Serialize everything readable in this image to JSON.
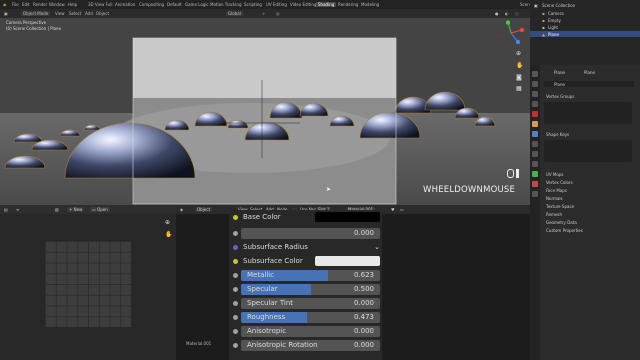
{
  "menu": {
    "items": [
      "File",
      "Edit",
      "Render",
      "Window",
      "Help"
    ],
    "workspaces": [
      "3D View Full",
      "Animation",
      "Compositing",
      "Default",
      "Game Logic",
      "Motion Tracking",
      "Scripting",
      "UV Editing",
      "Video Editing",
      "Shading",
      "Rendering",
      "Modeling"
    ],
    "active_workspace": "Shading",
    "scene": "Scene",
    "render_layer": "RenderLayer"
  },
  "viewport": {
    "mode": "Object Mode",
    "menu": [
      "View",
      "Select",
      "Add",
      "Object"
    ],
    "orientation": "Global",
    "info_line1": "Camera Perspective",
    "info_line2": "(0) Scene Collection | Plane",
    "overlay_text": "WHEELDOWNMOUSE"
  },
  "uv_editor": {
    "new_label": "New",
    "open_label": "Open"
  },
  "node_editor": {
    "mode": "Object",
    "menu": [
      "View",
      "Select",
      "Add",
      "Node"
    ],
    "use_nodes": "Use Nodes",
    "slot": "Slot 1",
    "material": "Material.001",
    "footer_material": "Material.001",
    "rows": [
      {
        "label": "Base Color",
        "kind": "color",
        "socket": "#c7c729",
        "swatch": "#000000"
      },
      {
        "label": "Subsurface Radius",
        "kind": "dropdown",
        "socket": "#6363c7"
      },
      {
        "label": "Subsurface Color",
        "kind": "color",
        "socket": "#c7c729",
        "swatch": "#e8e8e8"
      },
      {
        "label": "Metallic",
        "kind": "slider",
        "value": "0.623",
        "fill": 0.623,
        "socket": "#a1a1a1"
      },
      {
        "label": "Specular",
        "kind": "slider",
        "value": "0.500",
        "fill": 0.5,
        "socket": "#a1a1a1"
      },
      {
        "label": "Specular Tint",
        "kind": "slider",
        "value": "0.000",
        "fill": 0,
        "socket": "#a1a1a1"
      },
      {
        "label": "Roughness",
        "kind": "slider",
        "value": "0.473",
        "fill": 0.473,
        "socket": "#a1a1a1"
      },
      {
        "label": "Anisotropic",
        "kind": "slider",
        "value": "0.000",
        "fill": 0,
        "socket": "#a1a1a1"
      },
      {
        "label": "Anisotropic Rotation",
        "kind": "slider",
        "value": "0.000",
        "fill": 0,
        "socket": "#a1a1a1"
      }
    ],
    "subsurface_value": "0.000"
  },
  "outliner": {
    "root": "Scene Collection",
    "items": [
      "Camera",
      "Empty",
      "Light",
      "Plane"
    ]
  },
  "properties": {
    "object_name": "Plane",
    "data_name": "Plane",
    "mesh_field": "Plane",
    "panels": [
      "Vertex Groups",
      "Shape Keys"
    ],
    "sections": [
      "UV Maps",
      "Vertex Colors",
      "Face Maps",
      "Normals",
      "Texture Space",
      "Remesh",
      "Geometry Data",
      "Custom Properties"
    ]
  },
  "colors": {
    "accent": "#4772b3",
    "active_tab": "#5680c2"
  }
}
